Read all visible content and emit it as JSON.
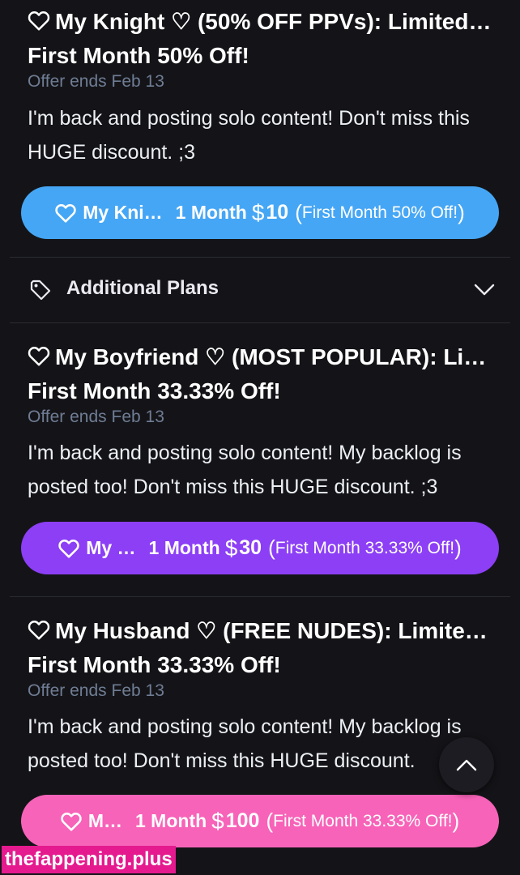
{
  "tiers": [
    {
      "title": "My Knight ♡ (50% OFF PPVs): Limited…",
      "subtitle": "First Month 50% Off!",
      "offer_ends": "Offer ends Feb 13",
      "description": "I'm back and posting solo content! Don't miss this HUGE discount. ;3",
      "button": {
        "name": "My Kni…",
        "duration": "1 Month",
        "currency": "$",
        "price": "10",
        "discount": "First Month 50% Off!",
        "color": "#45a6f5"
      }
    },
    {
      "title": "My Boyfriend ♡ (MOST POPULAR): Li…",
      "subtitle": "First Month 33.33% Off!",
      "offer_ends": "Offer ends Feb 13",
      "description": "I'm back and posting solo content! My backlog is posted too! Don't miss this HUGE discount. ;3",
      "button": {
        "name": "My …",
        "duration": "1 Month",
        "currency": "$",
        "price": "30",
        "discount": "First Month 33.33% Off!",
        "color": "#8c3ff5"
      }
    },
    {
      "title": "My Husband ♡ (FREE NUDES): Limited…",
      "subtitle": "First Month 33.33% Off!",
      "offer_ends": "Offer ends Feb 13",
      "description": "I'm back and posting solo content! My backlog is posted too! Don't miss this HUGE discount.",
      "button": {
        "name": "M…",
        "duration": "1 Month",
        "currency": "$",
        "price": "100",
        "discount": "First Month 33.33% Off!",
        "color": "#f763b8"
      }
    }
  ],
  "additional_plans": {
    "label": "Additional Plans",
    "icon": "tag-icon",
    "toggle_icon": "chevron-down-icon"
  },
  "scroll_top_icon": "chevron-up-icon",
  "watermark": "thefappening.plus",
  "colors": {
    "background": "#141418",
    "muted_text": "#6f7d94",
    "divider": "#2a2b33",
    "watermark_bg": "#e41a8e"
  }
}
